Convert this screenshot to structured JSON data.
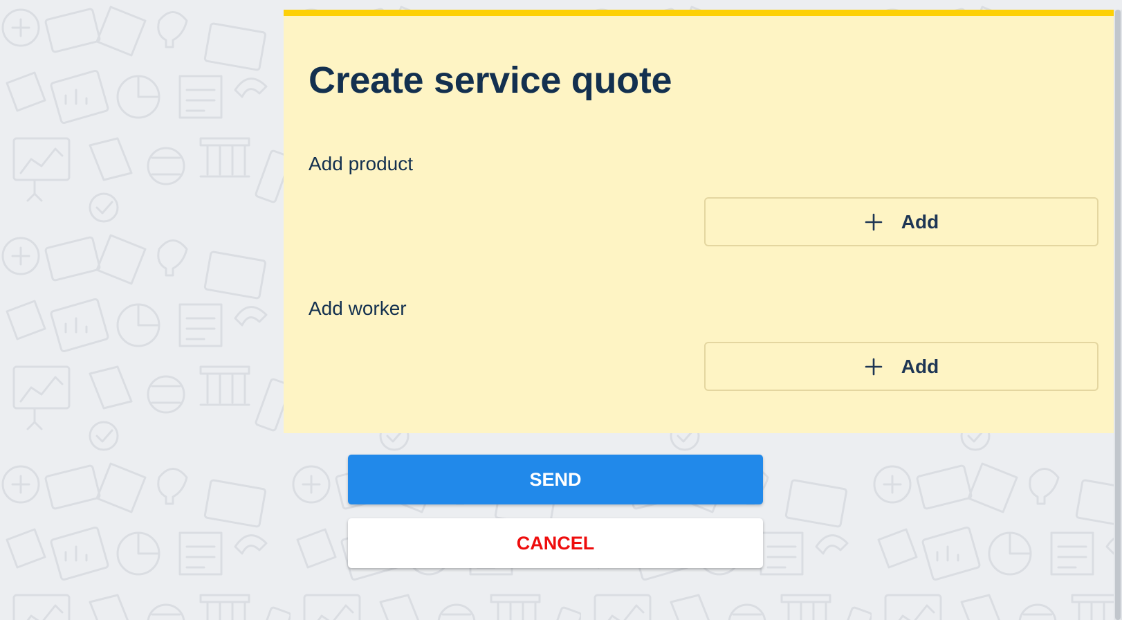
{
  "form": {
    "title": "Create service quote",
    "sections": [
      {
        "label": "Add product",
        "button_label": "Add",
        "button_icon": "plus-icon"
      },
      {
        "label": "Add worker",
        "button_label": "Add",
        "button_icon": "plus-icon"
      }
    ]
  },
  "actions": {
    "send_label": "SEND",
    "cancel_label": "CANCEL"
  },
  "colors": {
    "card_background": "#fef4c4",
    "card_accent": "#fdd005",
    "title_text": "#13304f",
    "send_button": "#2189ea",
    "cancel_text": "#ee0d0d",
    "page_background": "#eceef1"
  }
}
